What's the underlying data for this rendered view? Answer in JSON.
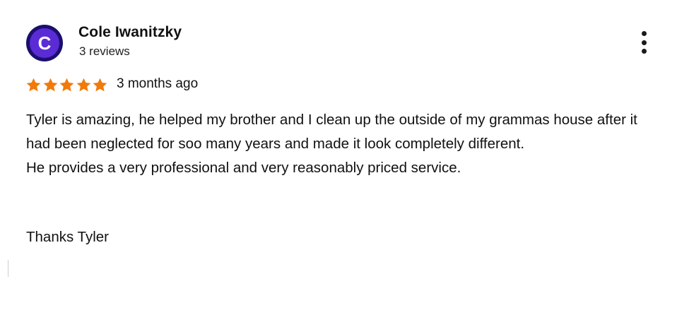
{
  "reviewer": {
    "initial": "C",
    "name": "Cole Iwanitzky",
    "review_count": "3 reviews"
  },
  "rating": {
    "stars": 5,
    "max": 5,
    "star_color": "#f17a0a",
    "date": "3 months ago"
  },
  "review": {
    "body_line_1": "Tyler is amazing, he helped my brother and I clean up the outside of my grammas house after it had been neglected for soo many years and made it look completely different.",
    "body_line_2": "He provides a very professional and very reasonably priced service.",
    "signoff": "Thanks Tyler"
  },
  "menu": {
    "icon": "more-vert-icon"
  },
  "colors": {
    "avatar_outer": "#1a0f6e",
    "avatar_inner": "#5b2bd6",
    "text": "#111111"
  }
}
